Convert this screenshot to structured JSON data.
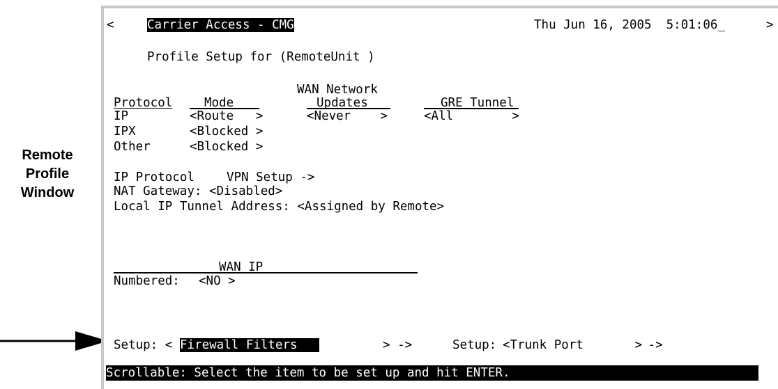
{
  "callout": {
    "line1": "Remote",
    "line2": "Profile",
    "line3": "Window"
  },
  "title_bar": {
    "left_nav": "<",
    "title": "Carrier Access - CMG",
    "datetime": "Thu Jun 16, 2005  5:01:06_",
    "right_nav": ">"
  },
  "screen_title": "Profile Setup for (RemoteUnit )",
  "table": {
    "header_wan_top": "WAN Network",
    "col_protocol": "Protocol",
    "col_mode": "Mode",
    "col_updates": "Updates",
    "col_gre": "GRE Tunnel",
    "rows": [
      {
        "protocol": "IP",
        "mode": "<Route   >",
        "updates": "<Never    >",
        "gre": "<All        >"
      },
      {
        "protocol": "IPX",
        "mode": "<Blocked >"
      },
      {
        "protocol": "Other",
        "mode": "<Blocked >"
      }
    ]
  },
  "ip_protocol": {
    "label": "IP Protocol",
    "vpn": "VPN Setup ->"
  },
  "nat": "NAT Gateway: <Disabled>",
  "local_tunnel": "Local IP Tunnel Address: <Assigned by Remote>",
  "wan_ip": {
    "header": "WAN IP",
    "label": "Numbered:",
    "value": "<NO >"
  },
  "setup1": {
    "label": "Setup: <",
    "value": "Firewall Filters   ",
    "suffix": "> ->"
  },
  "setup2": {
    "label": "Setup: ",
    "value": "<Trunk Port       >",
    "suffix": " ->"
  },
  "status": "Scrollable: Select the item to be set up and hit ENTER."
}
